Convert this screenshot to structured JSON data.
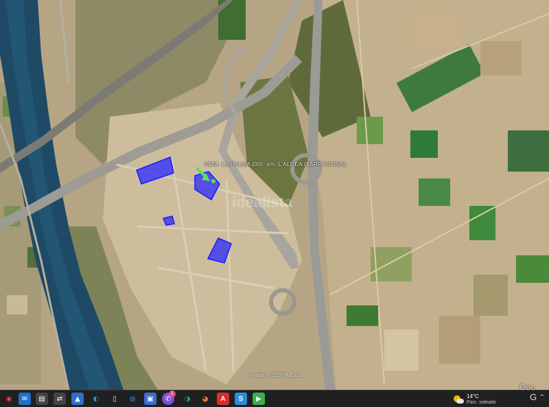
{
  "map": {
    "parcel_label": "NDM. LA PALMA (00), s/n, L'ALDEA (TARRAGONA)",
    "watermark": "idealista",
    "imagery_credit": "Image © 2026 Airbus",
    "brand": "Goo",
    "colors": {
      "parcel_fill": "#2a2aff",
      "marker": "#5ce05c",
      "river": "#1f4a66"
    }
  },
  "taskbar": {
    "buttons": [
      {
        "name": "chrome-icon",
        "glyph": "◉",
        "color": "#e8453c"
      },
      {
        "name": "outlook-icon",
        "glyph": "✉",
        "color": "#1a73c8"
      },
      {
        "name": "file-explorer-icon",
        "glyph": "▤",
        "color": "#3a3a3a"
      },
      {
        "name": "network-icon",
        "glyph": "⇄",
        "color": "#3a3a3a"
      },
      {
        "name": "photos-icon",
        "glyph": "▲",
        "color": "#2d6fcf"
      },
      {
        "name": "edge-icon",
        "glyph": "◐",
        "color": "#1a9bd7"
      },
      {
        "name": "document-icon",
        "glyph": "▯",
        "color": "#e8e8e8"
      },
      {
        "name": "image-viewer-icon",
        "glyph": "◍",
        "color": "#2f8ad6"
      },
      {
        "name": "save-icon",
        "glyph": "▣",
        "color": "#3c6bd1"
      },
      {
        "name": "viber-icon",
        "glyph": "✆",
        "color": "#7b4fd6"
      },
      {
        "name": "google-earth-icon",
        "glyph": "◑",
        "color": "#1fa6a0"
      },
      {
        "name": "firefox-icon",
        "glyph": "◕",
        "color": "#ff7139"
      },
      {
        "name": "acrobat-icon",
        "glyph": "A",
        "color": "#d92c2c"
      },
      {
        "name": "app-s-icon",
        "glyph": "S",
        "color": "#2a8fd6"
      },
      {
        "name": "media-player-icon",
        "glyph": "▶",
        "color": "#3cae4c"
      }
    ],
    "badge_count": "1",
    "weather": {
      "temperature": "14°C",
      "condition": "Parc. soleado"
    },
    "tray_glyph": "G",
    "tray_caret": "^"
  }
}
